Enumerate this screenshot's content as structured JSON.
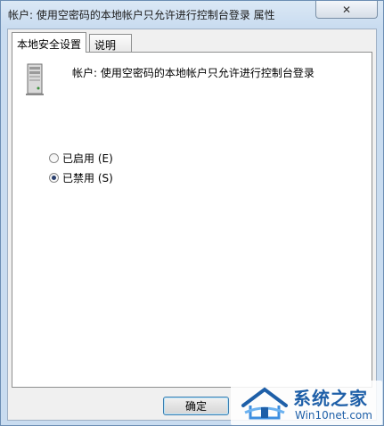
{
  "window": {
    "title": "帐户: 使用空密码的本地帐户只允许进行控制台登录 属性",
    "close_glyph": "✕"
  },
  "tabs": [
    {
      "label": "本地安全设置",
      "active": true
    },
    {
      "label": "说明",
      "active": false
    }
  ],
  "policy": {
    "name": "帐户: 使用空密码的本地帐户只允许进行控制台登录",
    "icon": "server-icon"
  },
  "options": [
    {
      "label": "已启用 (E)",
      "checked": false
    },
    {
      "label": "已禁用 (S)",
      "checked": true
    }
  ],
  "buttons": {
    "ok_label": "确定"
  },
  "watermark": {
    "title": "系统之家",
    "subtitle": "Win10net.com"
  },
  "colors": {
    "frame": "#c9dcf0",
    "panel": "#ffffff",
    "accent": "#1e5fa8"
  }
}
